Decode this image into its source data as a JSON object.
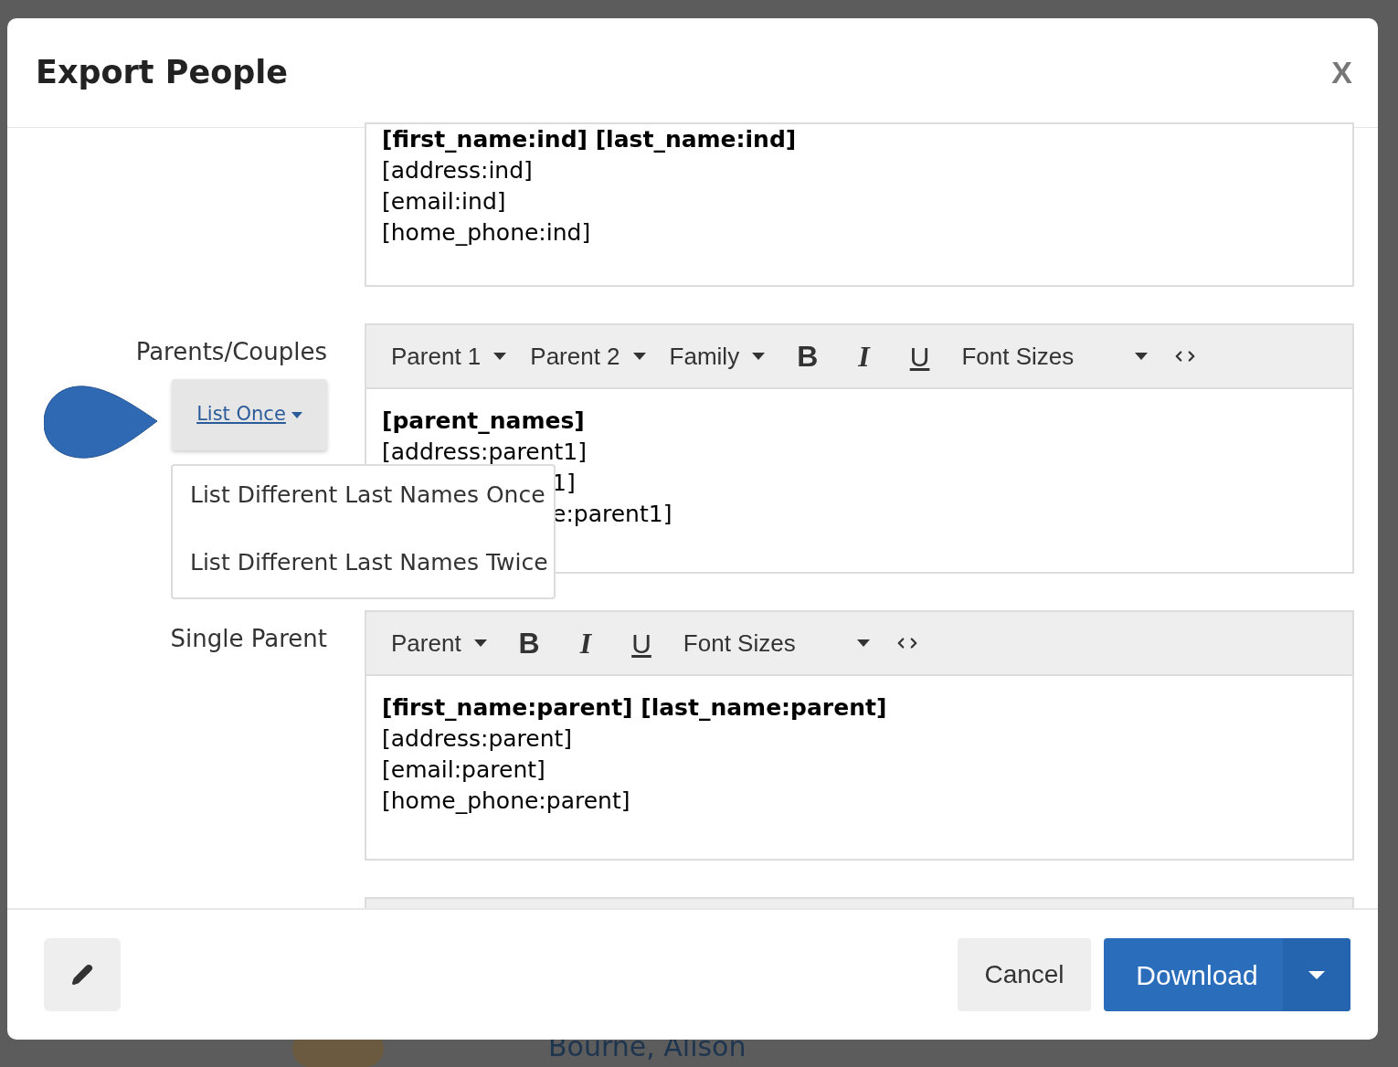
{
  "background": {
    "person_name": "Bourne, Alison"
  },
  "dialog": {
    "title": "Export People",
    "close": "X"
  },
  "editors": [
    {
      "lines": [
        {
          "text": "[first_name:ind] [last_name:ind]",
          "bold": true
        },
        {
          "text": "[address:ind]",
          "bold": false
        },
        {
          "text": "[email:ind]",
          "bold": false
        },
        {
          "text": "[home_phone:ind]",
          "bold": false
        }
      ]
    },
    {
      "label": "Parents/Couples",
      "option_button": {
        "text": "List Once",
        "open": true,
        "menu": [
          "List Different Last Names Once",
          "List Different Last Names Twice"
        ]
      },
      "toolbar": [
        {
          "kind": "menu",
          "text": "Parent 1"
        },
        {
          "kind": "menu",
          "text": "Parent 2"
        },
        {
          "kind": "menu",
          "text": "Family"
        },
        {
          "kind": "bold",
          "text": "B"
        },
        {
          "kind": "italic",
          "text": "I"
        },
        {
          "kind": "underline",
          "text": "U"
        },
        {
          "kind": "select",
          "text": "Font Sizes"
        },
        {
          "kind": "code"
        }
      ],
      "lines": [
        {
          "text": "[parent_names]",
          "bold": true
        },
        {
          "text": "[address:parent1]",
          "bold": false
        },
        {
          "text": "1]",
          "bold": false,
          "covered": true
        },
        {
          "text": "e:parent1]",
          "bold": false,
          "covered": true
        }
      ]
    },
    {
      "label": "Single Parent",
      "toolbar": [
        {
          "kind": "menu",
          "text": "Parent"
        },
        {
          "kind": "bold",
          "text": "B"
        },
        {
          "kind": "italic",
          "text": "I"
        },
        {
          "kind": "underline",
          "text": "U"
        },
        {
          "kind": "select",
          "text": "Font Sizes"
        },
        {
          "kind": "code"
        }
      ],
      "lines": [
        {
          "text": "[first_name:parent] [last_name:parent]",
          "bold": true
        },
        {
          "text": "[address:parent]",
          "bold": false
        },
        {
          "text": "[email:parent]",
          "bold": false
        },
        {
          "text": "[home_phone:parent]",
          "bold": false
        }
      ]
    }
  ],
  "footer": {
    "cancel": "Cancel",
    "download": "Download"
  }
}
